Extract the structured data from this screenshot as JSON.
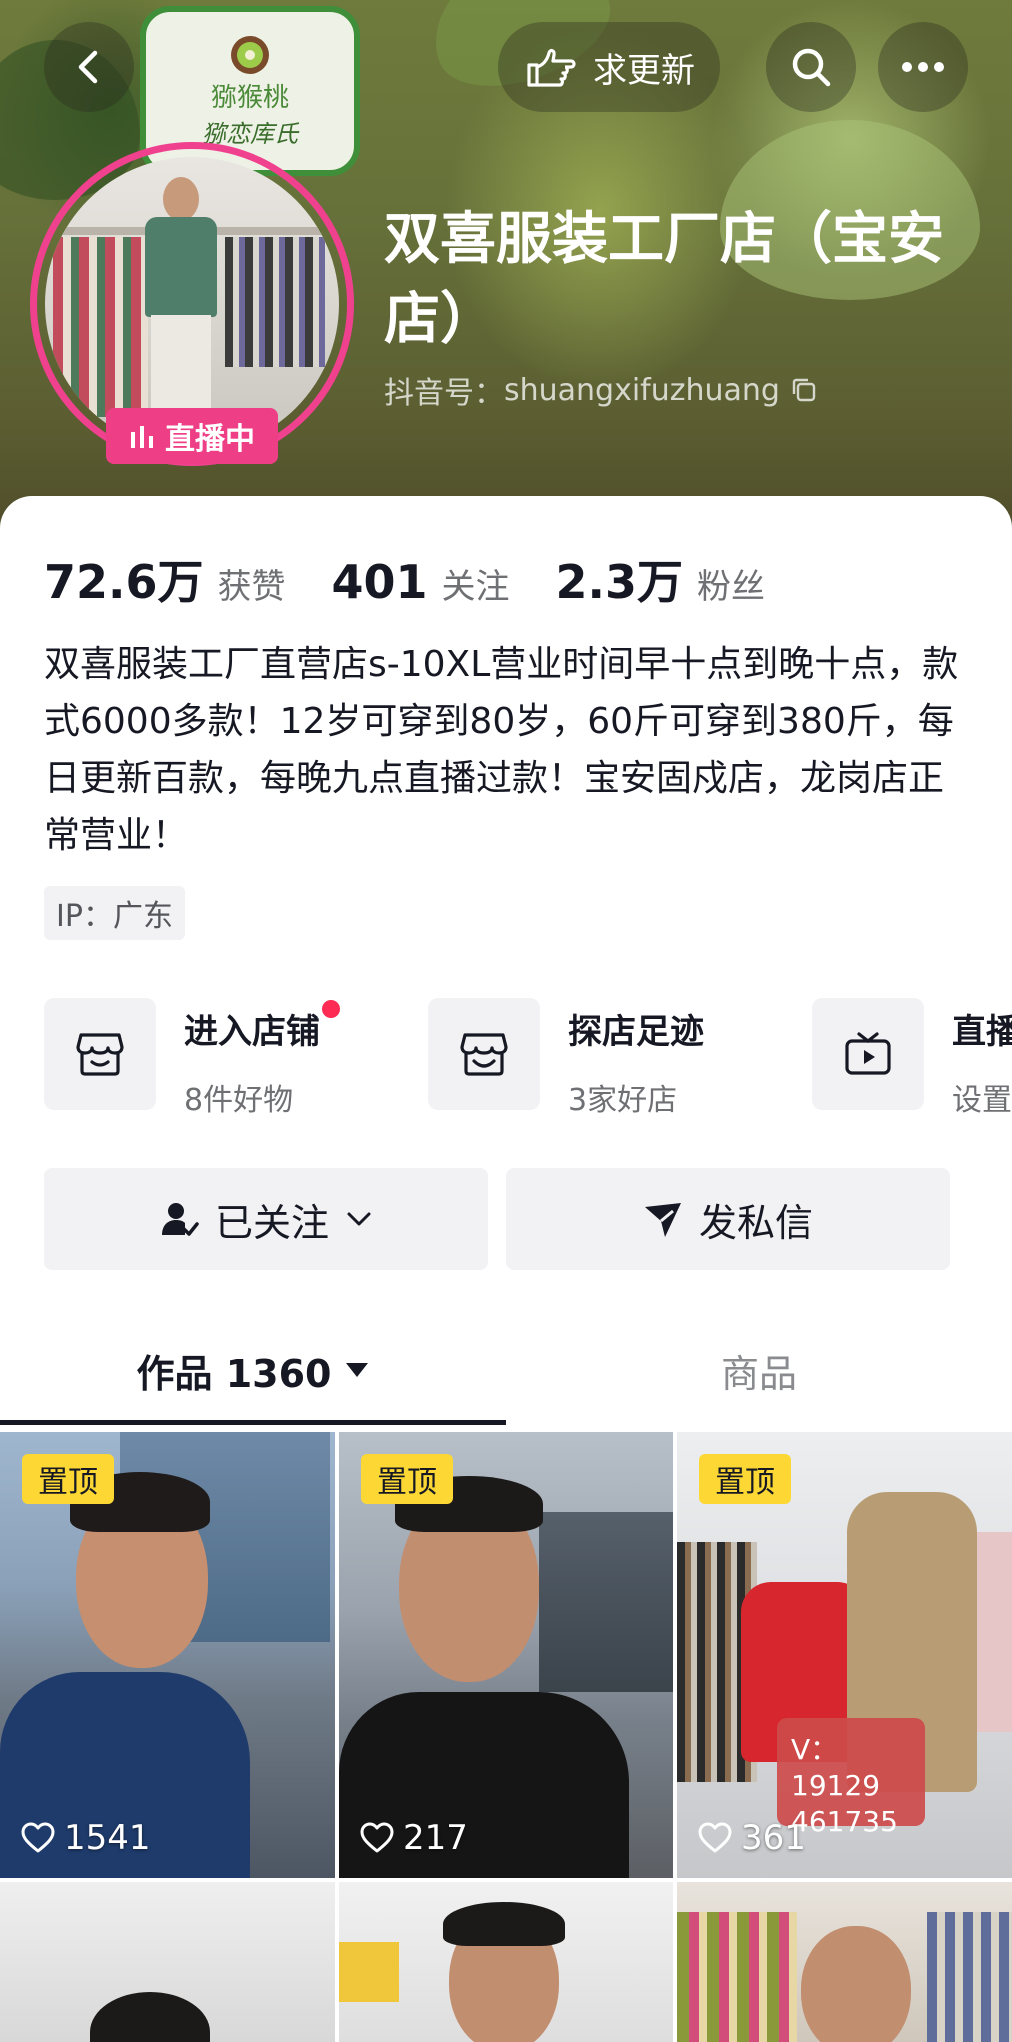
{
  "header": {
    "update_label": "求更新",
    "logo_text_1": "猕猴桃",
    "logo_text_2": "猕恋库氏",
    "live_label": "直播中",
    "shop_name": "双喜服装工厂店（宝安店）",
    "douyin_id_label": "抖音号：",
    "douyin_id": "shuangxifuzhuang"
  },
  "stats": [
    {
      "value": "72.6万",
      "label": "获赞"
    },
    {
      "value": "401",
      "label": "关注"
    },
    {
      "value": "2.3万",
      "label": "粉丝"
    }
  ],
  "bio": "双喜服装工厂直营店s-10XL营业时间早十点到晚十点，款式6000多款！12岁可穿到80岁，60斤可穿到380斤，每日更新百款，每晚九点直播过款！宝安固戍店，龙岗店正常营业！",
  "ip": "IP：广东",
  "entries": [
    {
      "title": "进入店铺",
      "sub": "8件好物",
      "icon": "store-icon"
    },
    {
      "title": "探店足迹",
      "sub": "3家好店",
      "icon": "store-visit-icon"
    },
    {
      "title": "直播",
      "sub": "设置",
      "icon": "tv-icon"
    }
  ],
  "actions": {
    "follow_label": "已关注",
    "message_label": "发私信"
  },
  "tabs": {
    "works_label": "作品 1360",
    "goods_label": "商品"
  },
  "videos": [
    {
      "pinned": "置顶",
      "likes": "1541"
    },
    {
      "pinned": "置顶",
      "likes": "217"
    },
    {
      "pinned": "置顶",
      "likes": "361",
      "tag": "V：19129 461735"
    }
  ],
  "colors": {
    "live_pink": "#ee3e86",
    "pin_yellow": "#fdd835",
    "red_dot": "#fe2c55"
  }
}
